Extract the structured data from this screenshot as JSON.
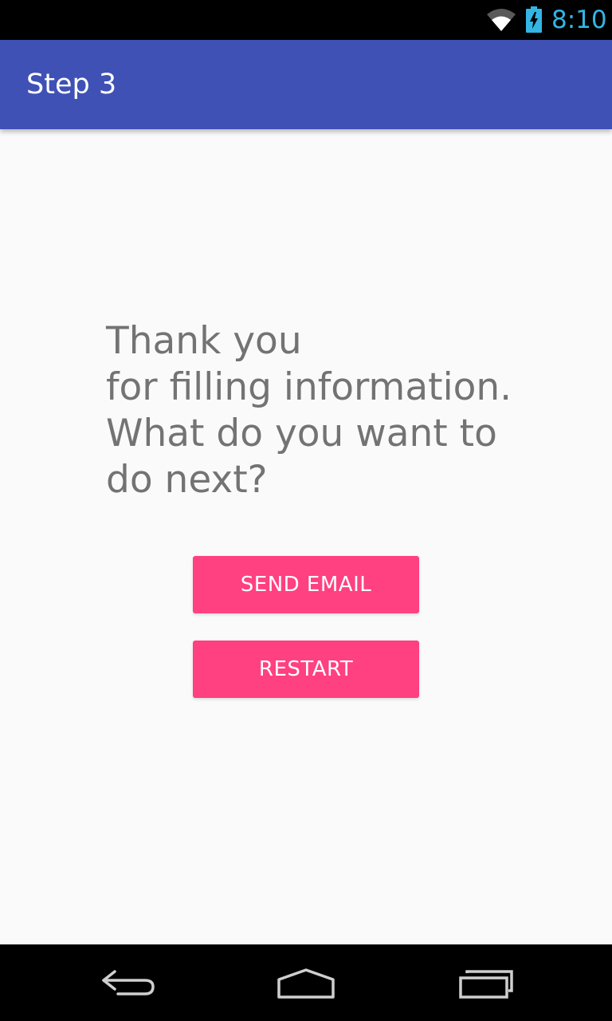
{
  "status_bar": {
    "time": "8:10",
    "icons": [
      "wifi-icon",
      "battery-charging-icon"
    ],
    "clock_color": "#33b5e5"
  },
  "app_bar": {
    "title": "Step 3",
    "color": "#3f51b5"
  },
  "message": {
    "lines": [
      "Thank you",
      "for filling information.",
      "What do you want to",
      "do next?"
    ]
  },
  "buttons": {
    "send_email": "SEND EMAIL",
    "restart": "RESTART",
    "accent_color": "#ff4081"
  },
  "nav_bar": {
    "icons": [
      "back-icon",
      "home-icon",
      "recents-icon"
    ]
  }
}
